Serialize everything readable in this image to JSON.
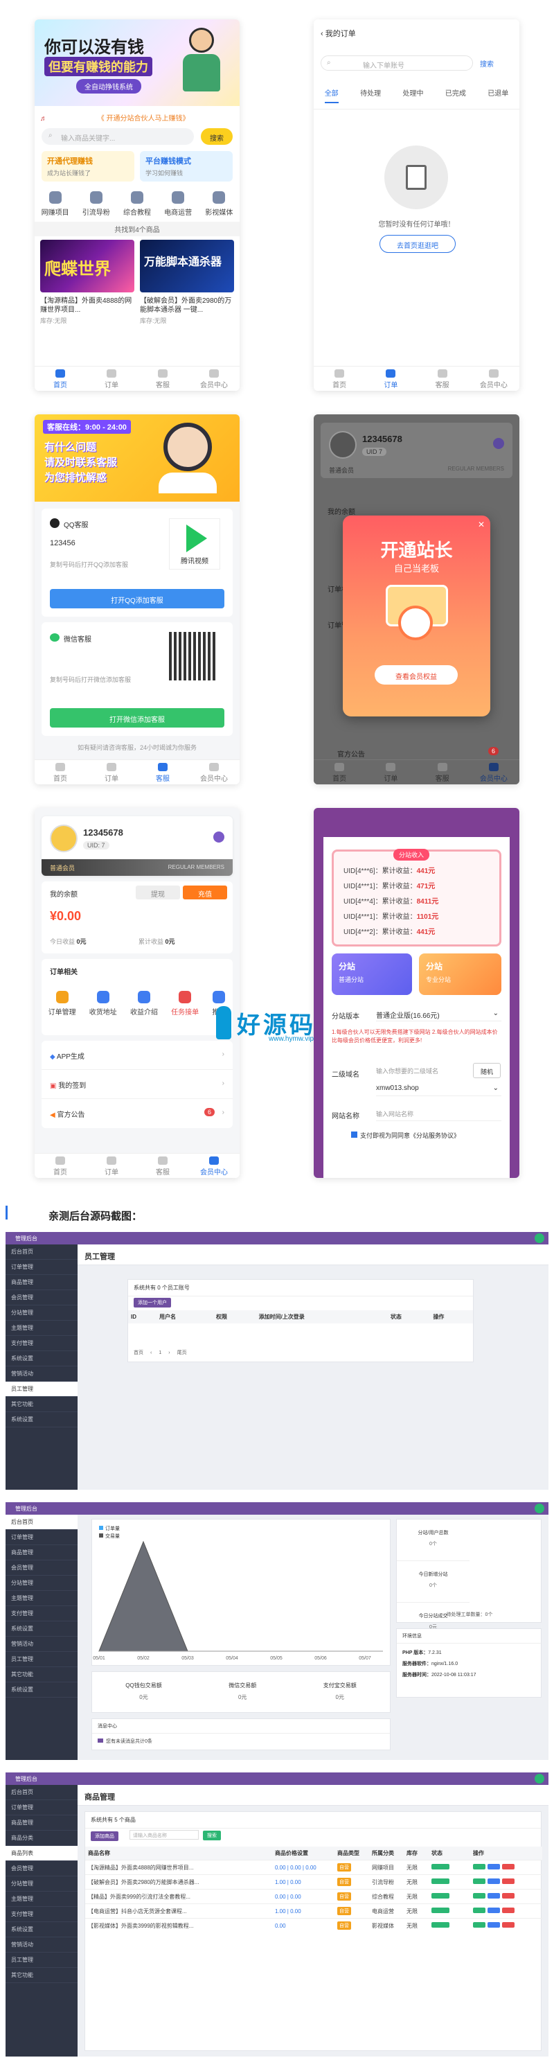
{
  "app1": {
    "banner_title": "你可以没有钱",
    "banner_sub": "但要有赚钱的能力",
    "banner_btn": "全自动挣钱系统",
    "notice": "《 开通分站合伙人马上赚钱》",
    "search_placeholder": "输入商品关键字...",
    "search_btn": "搜索",
    "promo1_title": "开通代理赚钱",
    "promo1_sub": "成为站长赚钱了",
    "promo2_title": "平台赚钱模式",
    "promo2_sub": "学习如何赚钱",
    "cats": [
      "网赚项目",
      "引流导粉",
      "综合教程",
      "电商运营",
      "影视媒体"
    ],
    "count_text": "共找到4个商品",
    "goods": [
      {
        "title": "【淘源精品】外面卖4888的网赚世界项目...",
        "price": "库存:无限"
      },
      {
        "title": "【破解会员】外面卖2980的万能脚本通杀器 一键...",
        "price": "库存:无限"
      }
    ],
    "nav": [
      "首页",
      "订单",
      "客服",
      "会员中心"
    ]
  },
  "app2": {
    "title": "我的订单",
    "search_placeholder": "输入下单账号",
    "search_btn": "搜索",
    "tabs": [
      "全部",
      "待处理",
      "处理中",
      "已完成",
      "已退单"
    ],
    "empty_text": "您暂时没有任何订单哦！",
    "empty_btn": "去首页逛逛吧",
    "nav": [
      "首页",
      "订单",
      "客服",
      "会员中心"
    ]
  },
  "app3": {
    "banner_line1": "客服在线：9:00 - 24:00",
    "banner_line2": "有什么问题",
    "banner_line3": "请及时联系客服",
    "banner_line4": "为您排忧解惑",
    "qq_label": "QQ客服",
    "qq_number": "123456",
    "qq_tip": "复制号码后打开QQ添加客服",
    "qq_logo": "腾讯视频",
    "qq_btn": "打开QQ添加客服",
    "wx_label": "微信客服",
    "wx_tip": "复制号码后打开微信添加客服",
    "wx_btn": "打开微信添加客服",
    "footer": "如有疑问请咨询客服，24小时竭诚为你服务",
    "nav": [
      "首页",
      "订单",
      "客服",
      "会员中心"
    ]
  },
  "app4": {
    "user": "12345678",
    "uid": "UID 7",
    "level": "普通会员",
    "level_en": "REGULAR MEMBERS",
    "popup_title": "开通站长",
    "popup_sub": "自己当老板",
    "popup_btn": "查看会员权益",
    "rows": [
      "我的余额",
      "订单相关",
      "订单管理",
      "官方公告"
    ],
    "badge": "6",
    "nav": [
      "首页",
      "订单",
      "客服",
      "会员中心"
    ]
  },
  "app5": {
    "user": "12345678",
    "uid": "UID: 7",
    "level": "普通会员",
    "level_en": "REGULAR MEMBERS",
    "balance_label": "我的余额",
    "withdraw": "提现",
    "recharge": "充值",
    "balance": "0.00",
    "today_label": "今日收益",
    "today_val": "0元",
    "total_label": "累计收益",
    "total_val": "0元",
    "orders_title": "订单相关",
    "orders": [
      "订单管理",
      "收货地址",
      "收益介绍",
      "任务接单",
      "推广"
    ],
    "menu": [
      "APP生成",
      "我的签到",
      "官方公告"
    ],
    "badge": "6",
    "nav": [
      "首页",
      "订单",
      "客服",
      "会员中心"
    ]
  },
  "app6": {
    "news_badge": "分站收入",
    "rows": [
      {
        "uid": "UID[4***6]：",
        "text": "累计收益",
        "amt": "441元"
      },
      {
        "uid": "UID[4***1]：",
        "text": "累计收益",
        "amt": "471元"
      },
      {
        "uid": "UID[4***4]：",
        "text": "累计收益",
        "amt": "8411元"
      },
      {
        "uid": "UID[4***1]：",
        "text": "累计收益",
        "amt": "1101元"
      },
      {
        "uid": "UID[4***2]：",
        "text": "累计收益",
        "amt": "441元"
      }
    ],
    "card1": "分站",
    "card1_sub": "普通分站",
    "card2": "分站",
    "card2_sub": "专业分站",
    "version_label": "分站版本",
    "version_val": "普通企业版(16.66元)",
    "warn": "1.每级合伙人可以无限免费搭建下级网站 2.每级合伙人的网站成本价比每级会员价格低更便宜，利润更多!",
    "domain_label": "二级域名",
    "domain_placeholder": "输入你想要的二级域名",
    "domain_btn": "随机",
    "domain_suffix": "xmw013.shop",
    "name_label": "网站名称",
    "name_placeholder": "输入网站名称",
    "agree": "支付即视为同同意《分站服务协议》"
  },
  "watermark": "好源码",
  "watermark_url": "www.hymw.vip",
  "section_title": "亲测后台源码截图：",
  "admin1": {
    "brand": "管理后台",
    "menu": [
      "后台首页",
      "订单管理",
      "商品管理",
      "会员管理",
      "分站管理",
      "主题管理",
      "支付管理",
      "系统设置",
      "营销活动",
      "员工管理",
      "其它功能",
      "系统设置"
    ],
    "page_title": "员工管理",
    "card_title": "系统共有 0 个员工账号",
    "add_btn": "添加一个用户",
    "cols": [
      "ID",
      "用户名",
      "权限",
      "添加时间/上次登录",
      "状态",
      "操作"
    ],
    "pager": [
      "首页",
      "‹",
      "1",
      "›",
      "尾页"
    ]
  },
  "admin2": {
    "brand": "管理后台",
    "menu": [
      "后台首页",
      "订单管理",
      "商品管理",
      "会员管理",
      "分站管理",
      "主题管理",
      "支付管理",
      "系统设置",
      "营销活动",
      "员工管理",
      "其它功能",
      "系统设置"
    ],
    "legend": [
      "订单量",
      "交易量"
    ],
    "xlabels": [
      "05/01",
      "05/02",
      "05/03",
      "05/04",
      "05/05",
      "05/06",
      "05/07"
    ],
    "stats": [
      {
        "t": "分站/用户总数",
        "v": "0个"
      },
      {
        "t": "今日新增分站",
        "v": "0个"
      },
      {
        "t": "今日分站成交",
        "v": "0元"
      },
      {
        "t": "待处理提现",
        "v": "0元"
      }
    ],
    "stats2": [
      "QQ钱包交易额",
      "微信交易额",
      "支付宝交易额"
    ],
    "stats2_val": "0元",
    "sys_title": "环境信息",
    "sys": [
      {
        "k": "PHP 版本：",
        "v": "7.2.31"
      },
      {
        "k": "服务器软件：",
        "v": "nginx/1.16.0"
      },
      {
        "k": "服务器时间：",
        "v": "2022-10-08 11:03:17"
      }
    ],
    "pending": "待处理工单数量：0个",
    "msg_title": "消息中心",
    "msg": "您有未读消息共计0条"
  },
  "admin3": {
    "brand": "管理后台",
    "menu": [
      "后台首页",
      "订单管理",
      "商品管理",
      "商品分类",
      "商品列表",
      "会员管理",
      "分站管理",
      "主题管理",
      "支付管理",
      "系统设置",
      "营销活动",
      "员工管理",
      "其它功能"
    ],
    "page_title": "商品管理",
    "card_title": "系统共有 5 个商品",
    "add_btn": "添加商品",
    "search_placeholder": "请输入商品名称",
    "search_btn": "搜索",
    "cols": [
      "商品名称",
      "商品价格设置",
      "商品类型",
      "所属分类",
      "库存",
      "状态",
      "操作"
    ],
    "rows": [
      {
        "n": "【淘源精品】外面卖4888的网赚世界项目...",
        "p": "0.00 | 0.00 | 0.00",
        "t": "自营",
        "c": "网赚项目",
        "s": "无限"
      },
      {
        "n": "【破解会员】外面卖2980的万能脚本通杀器...",
        "p": "1.00 | 0.00",
        "t": "自营",
        "c": "引流导粉",
        "s": "无限"
      },
      {
        "n": "【精品】外面卖999的引流打法全套教程...",
        "p": "0.00 | 0.00",
        "t": "自营",
        "c": "综合教程",
        "s": "无限"
      },
      {
        "n": "【电商运营】抖音小店无货源全套课程...",
        "p": "1.00 | 0.00",
        "t": "自营",
        "c": "电商运营",
        "s": "无限"
      },
      {
        "n": "【影视媒体】外面卖3999的影视剪辑教程...",
        "p": "0.00",
        "t": "自营",
        "c": "影视媒体",
        "s": "无限"
      }
    ]
  }
}
